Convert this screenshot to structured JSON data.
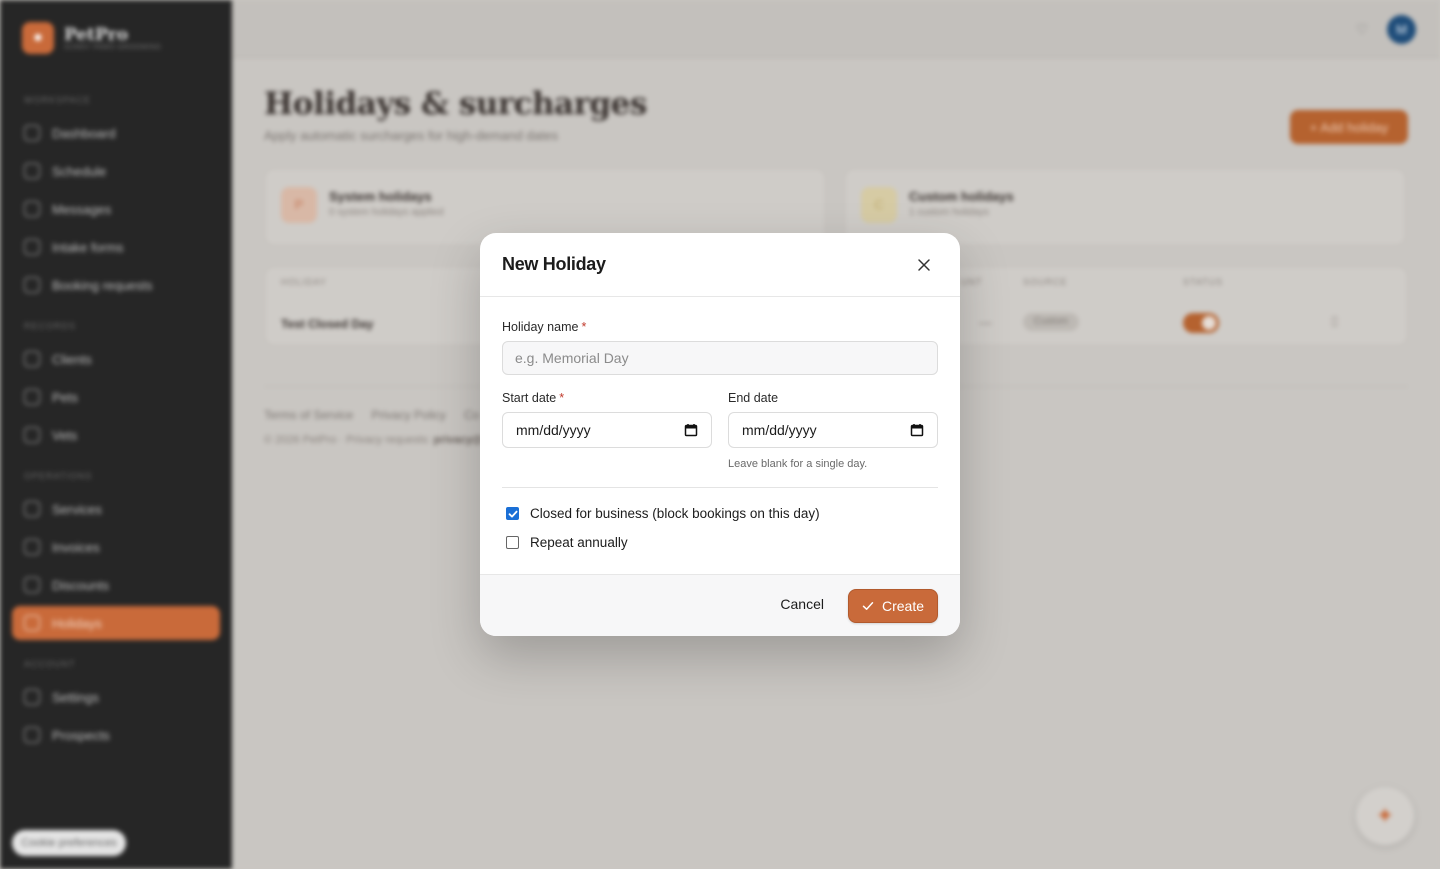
{
  "brand": {
    "name": "PetPro",
    "subtitle": "SUNNY PAWS GROOMING",
    "logo_icon": "paw-icon"
  },
  "sidebar": {
    "sections": [
      {
        "label": "WORKSPACE"
      },
      {
        "label": "RECORDS"
      },
      {
        "label": "OPERATIONS"
      },
      {
        "label": "ACCOUNT"
      }
    ],
    "items": [
      {
        "label": "Dashboard",
        "icon": "home-icon"
      },
      {
        "label": "Schedule",
        "icon": "calendar-icon"
      },
      {
        "label": "Messages",
        "icon": "chat-icon"
      },
      {
        "label": "Intake forms",
        "icon": "form-icon"
      },
      {
        "label": "Booking requests",
        "icon": "inbox-icon"
      },
      {
        "label": "Clients",
        "icon": "users-icon"
      },
      {
        "label": "Pets",
        "icon": "paw-icon"
      },
      {
        "label": "Vets",
        "icon": "stethoscope-icon"
      },
      {
        "label": "Services",
        "icon": "star-icon"
      },
      {
        "label": "Invoices",
        "icon": "invoice-icon"
      },
      {
        "label": "Discounts",
        "icon": "tag-icon"
      },
      {
        "label": "Holidays",
        "icon": "flag-icon",
        "active": true
      },
      {
        "label": "Settings",
        "icon": "gear-icon"
      },
      {
        "label": "Prospects",
        "icon": "users-icon"
      }
    ],
    "cookie_label": "Cookie preferences"
  },
  "topbar": {
    "avatar_initial": "M"
  },
  "page": {
    "title": "Holidays & surcharges",
    "subtitle": "Apply automatic surcharges for high-demand dates",
    "add_button": "+ Add holiday"
  },
  "cards": [
    {
      "icon_text": "P",
      "title": "System holidays",
      "subtitle": "0 system holidays applied"
    },
    {
      "icon_text": "C",
      "title": "Custom holidays",
      "subtitle": "1 custom holidays"
    }
  ],
  "table": {
    "headers": [
      "HOLIDAY",
      "UNT",
      "SOURCE",
      "STATUS"
    ],
    "rows": [
      {
        "name": "Test Closed Day",
        "amount": "—",
        "source": "Custom",
        "status_on": true
      }
    ]
  },
  "footer": {
    "links": [
      "Terms of Service",
      "Privacy Policy",
      "Co"
    ],
    "copyright": "© 2026 PetPro · Privacy requests:",
    "email": "privacy@"
  },
  "modal": {
    "title": "New Holiday",
    "name_label": "Holiday name",
    "name_placeholder": "e.g. Memorial Day",
    "name_value": "",
    "start_label": "Start date",
    "start_value": "mm/dd/yyyy",
    "end_label": "End date",
    "end_value": "mm/dd/yyyy",
    "end_hint": "Leave blank for a single day.",
    "required_mark": "*",
    "closed_label": "Closed for business (block bookings on this day)",
    "closed_checked": true,
    "repeat_label": "Repeat annually",
    "repeat_checked": false,
    "cancel_label": "Cancel",
    "create_label": "Create"
  },
  "colors": {
    "accent": "#c96a3a",
    "checkbox": "#1a6fd6",
    "sidebar_bg": "#262626"
  }
}
